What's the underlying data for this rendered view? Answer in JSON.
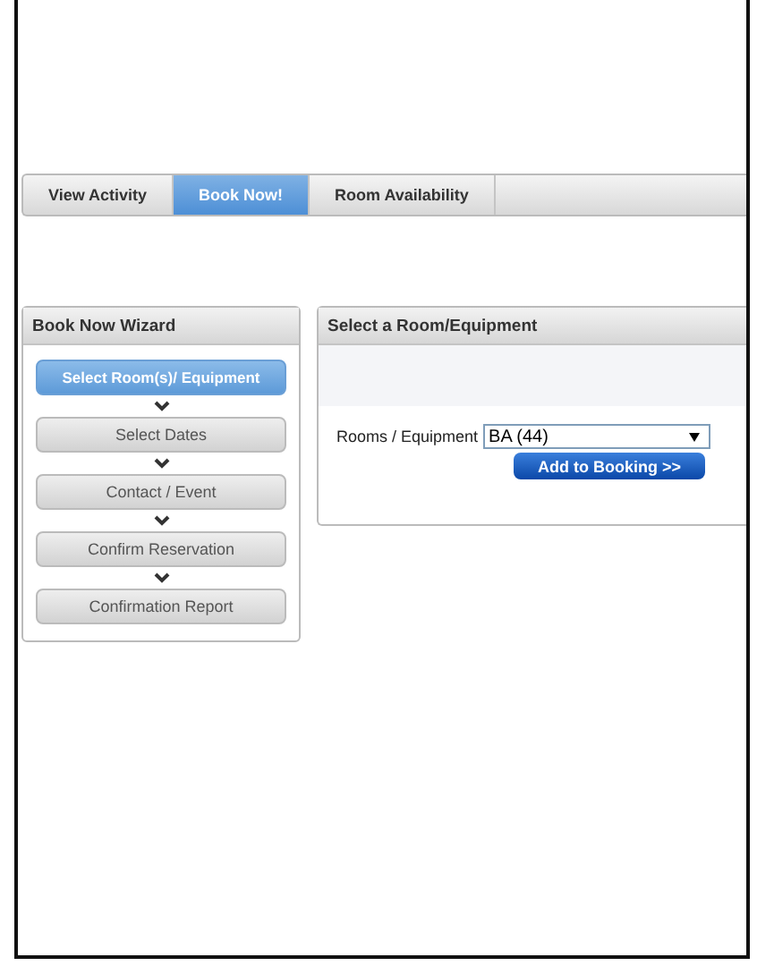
{
  "tabs": [
    {
      "label": "View Activity",
      "selected": false
    },
    {
      "label": "Book Now!",
      "selected": true
    },
    {
      "label": "Room Availability",
      "selected": false
    }
  ],
  "wizard": {
    "title": "Book Now Wizard",
    "steps": [
      {
        "label": "Select Room(s)/ Equipment",
        "selected": true
      },
      {
        "label": "Select Dates",
        "selected": false
      },
      {
        "label": "Contact / Event",
        "selected": false
      },
      {
        "label": "Confirm Reservation",
        "selected": false
      },
      {
        "label": "Confirmation Report",
        "selected": false
      }
    ]
  },
  "panel": {
    "title": "Select a Room/Equipment",
    "field_label": "Rooms / Equipment",
    "select_value": "BA (44)",
    "button": "Add to Booking >>"
  }
}
